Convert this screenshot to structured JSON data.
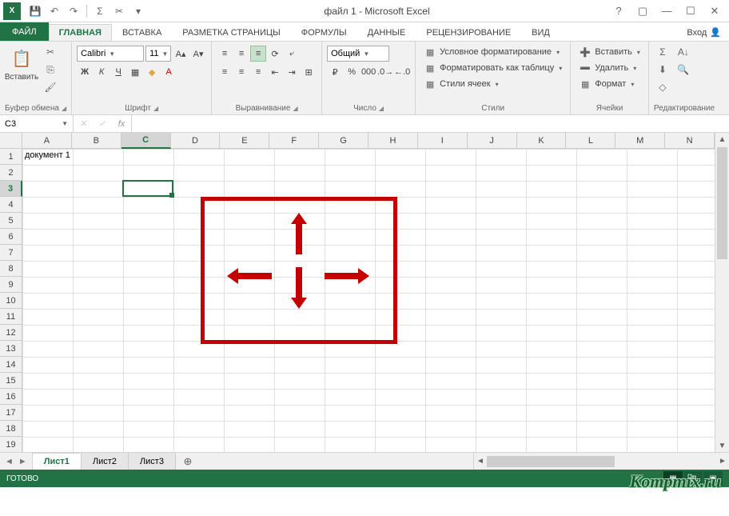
{
  "title": "файл 1 - Microsoft Excel",
  "qat": {
    "save": "💾",
    "undo": "↶",
    "redo": "↷",
    "sum": "Σ",
    "cut": "✂"
  },
  "tabs": {
    "file": "ФАЙЛ",
    "home": "ГЛАВНАЯ",
    "insert": "ВСТАВКА",
    "layout": "РАЗМЕТКА СТРАНИЦЫ",
    "formulas": "ФОРМУЛЫ",
    "data": "ДАННЫЕ",
    "review": "РЕЦЕНЗИРОВАНИЕ",
    "view": "ВИД",
    "signin": "Вход"
  },
  "ribbon": {
    "clipboard": {
      "paste": "Вставить",
      "label": "Буфер обмена"
    },
    "font": {
      "name": "Calibri",
      "size": "11",
      "label": "Шрифт"
    },
    "align": {
      "label": "Выравнивание"
    },
    "number": {
      "format": "Общий",
      "label": "Число"
    },
    "styles": {
      "cond": "Условное форматирование",
      "table": "Форматировать как таблицу",
      "cell": "Стили ячеек",
      "label": "Стили"
    },
    "cells": {
      "insert": "Вставить",
      "delete": "Удалить",
      "format": "Формат",
      "label": "Ячейки"
    },
    "editing": {
      "label": "Редактирование"
    }
  },
  "namebox": "C3",
  "columns": [
    "A",
    "B",
    "C",
    "D",
    "E",
    "F",
    "G",
    "H",
    "I",
    "J",
    "K",
    "L",
    "M",
    "N"
  ],
  "rows": 19,
  "selectedCol": 2,
  "selectedRow": 2,
  "cellA1": "документ 1",
  "sheets": {
    "s1": "Лист1",
    "s2": "Лист2",
    "s3": "Лист3"
  },
  "status": "ГОТОВО",
  "watermark": "Kompmix.ru"
}
